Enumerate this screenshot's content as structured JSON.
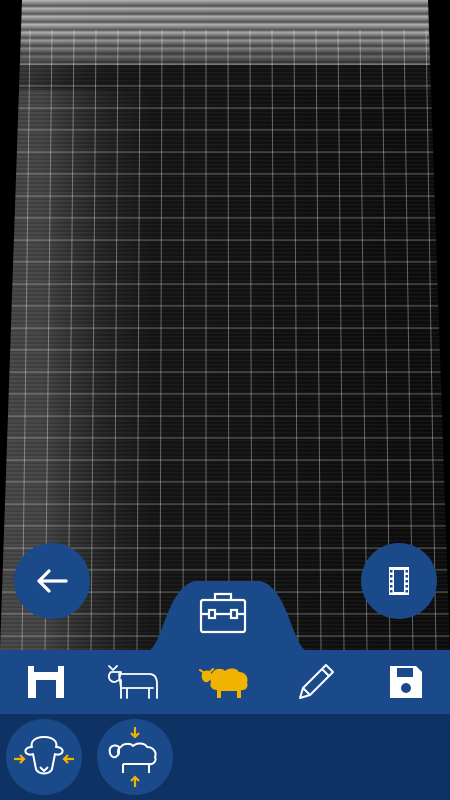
{
  "scan": {
    "grid": true,
    "view": "ultrasound-image"
  },
  "buttons": {
    "back": {
      "icon": "arrow-left-icon"
    },
    "video": {
      "icon": "film-icon"
    },
    "toolbox": {
      "icon": "toolbox-icon"
    }
  },
  "toolbar": {
    "items": [
      {
        "icon": "caliper-icon",
        "active": false
      },
      {
        "icon": "cow-icon",
        "active": false
      },
      {
        "icon": "sheep-icon",
        "active": true
      },
      {
        "icon": "pencil-icon",
        "active": false
      },
      {
        "icon": "save-icon",
        "active": false
      }
    ]
  },
  "sub_toolbar": {
    "items": [
      {
        "icon": "sheep-head-width-icon"
      },
      {
        "icon": "sheep-height-icon"
      }
    ]
  },
  "colors": {
    "primary": "#1a4a8a",
    "secondary": "#0e3263",
    "accent": "#f0b400",
    "icon": "#ffffff"
  }
}
